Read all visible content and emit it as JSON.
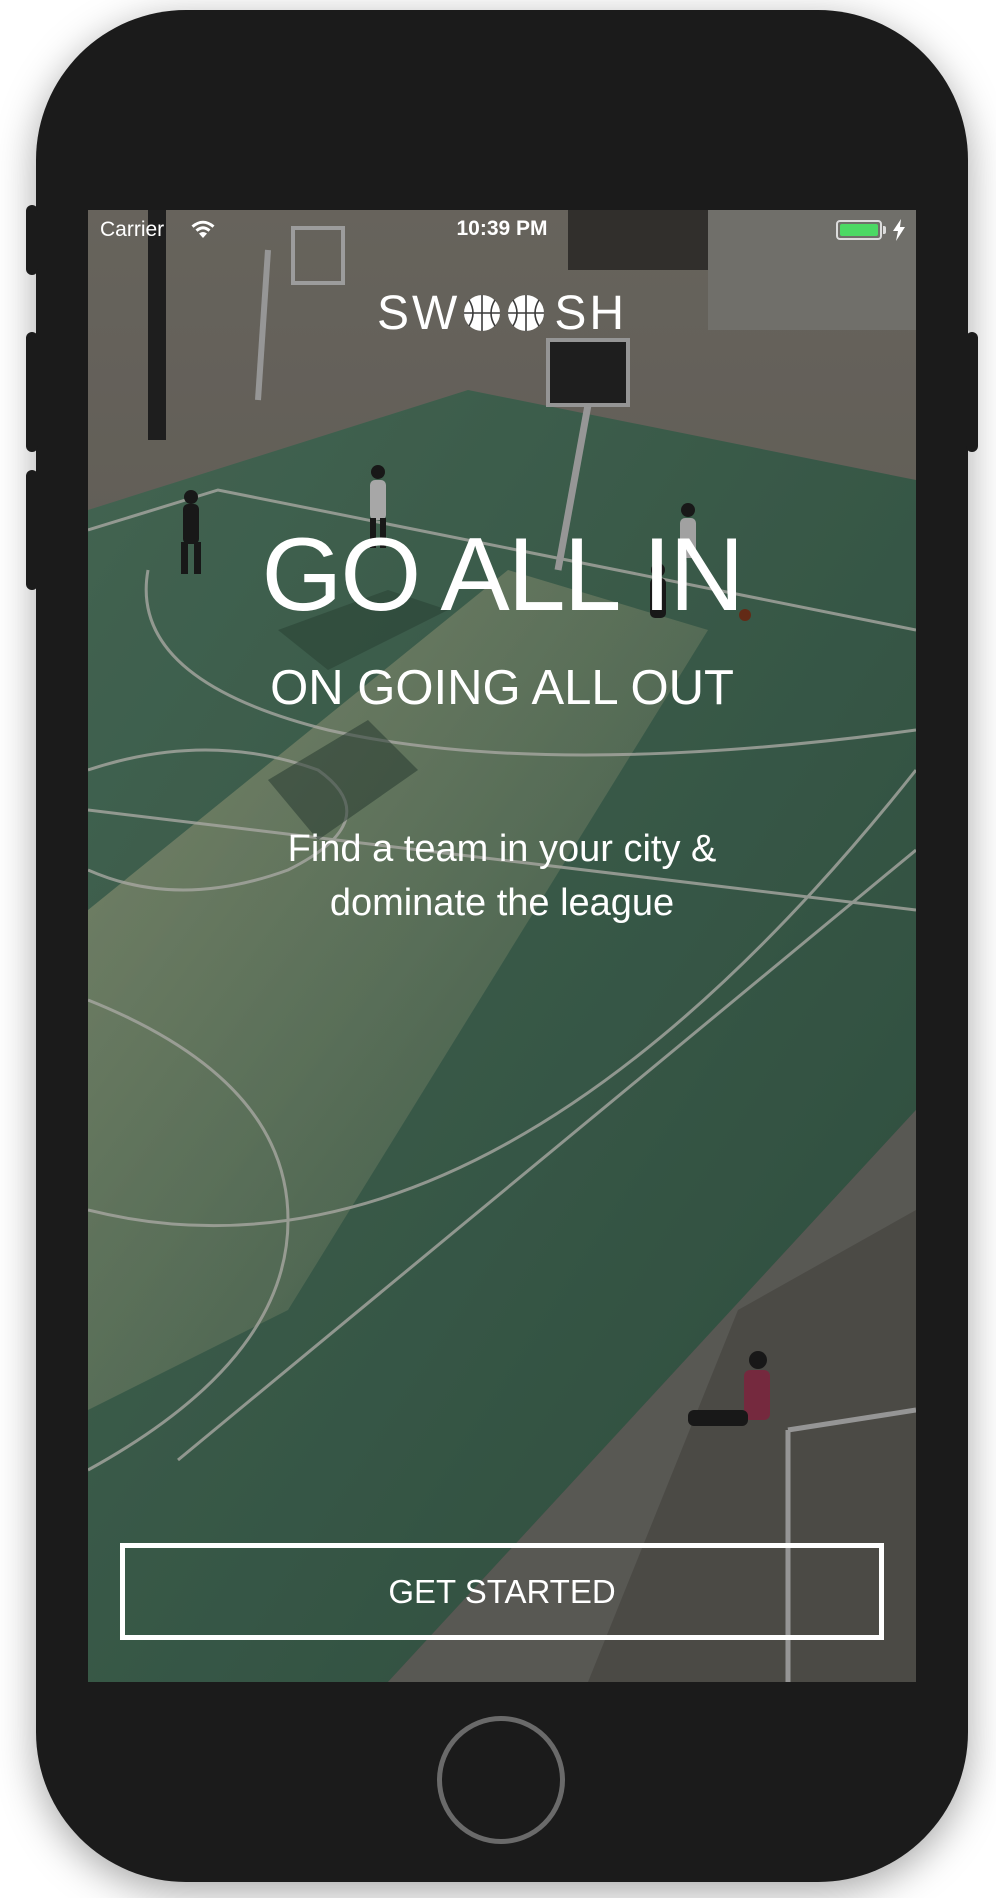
{
  "status_bar": {
    "carrier": "Carrier",
    "time": "10:39 PM",
    "battery_color": "#4cd964"
  },
  "logo": {
    "prefix": "SW",
    "suffix": "SH",
    "ball_icon": "basketball-icon"
  },
  "hero": {
    "headline": "GO ALL IN",
    "subhead": "ON GOING ALL OUT",
    "tagline_line1": "Find a team in your city &",
    "tagline_line2": "dominate the league"
  },
  "cta": {
    "label": "GET STARTED"
  },
  "colors": {
    "court": "#3f5a4c",
    "device": "#1b1b1b",
    "text": "#ffffff"
  }
}
